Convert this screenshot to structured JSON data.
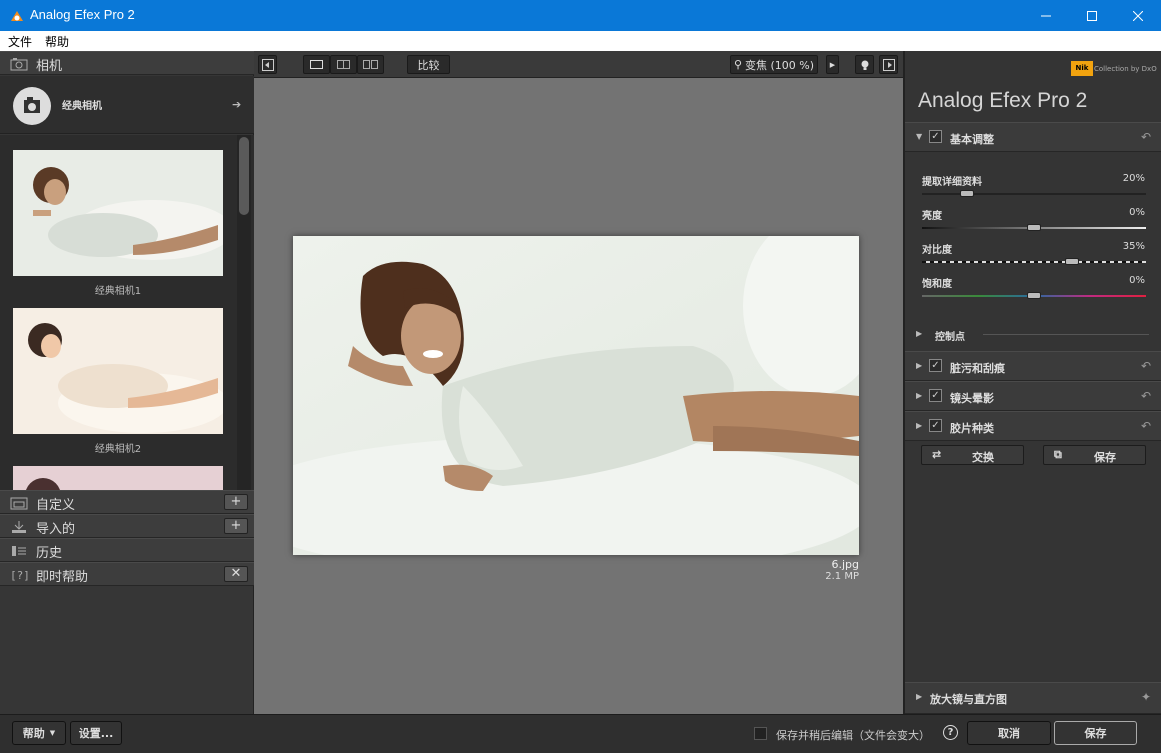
{
  "window": {
    "title": "Analog Efex Pro 2"
  },
  "menu": [
    "文件",
    "帮助"
  ],
  "left_panel": {
    "header_camera": "相机",
    "camera_label": "经典相机",
    "thumbnails": [
      {
        "label": "经典相机1"
      },
      {
        "label": "经典相机2"
      }
    ],
    "sections": [
      {
        "label": "自定义",
        "icon": "folder-icon",
        "action": "+"
      },
      {
        "label": "导入的",
        "icon": "import-icon",
        "action": "+"
      },
      {
        "label": "历史",
        "icon": "history-icon",
        "action": ""
      },
      {
        "label": "即时帮助",
        "icon": "help-icon",
        "action": "✕"
      }
    ]
  },
  "toolbar": {
    "compare_label": "比较",
    "zoom_label": "变焦 (100 %)"
  },
  "canvas": {
    "file_name": "6.jpg",
    "file_size": "2.1 MP"
  },
  "right_panel": {
    "brand_logo": "Nik",
    "brand_text": "Collection by DxO",
    "product_title": "Analog Efex Pro 2",
    "basic_section": "基本调整",
    "sliders": [
      {
        "label": "提取详细资料",
        "value": "20%",
        "level": 0.2
      },
      {
        "label": "亮度",
        "value": "0%",
        "level": 0.5
      },
      {
        "label": "对比度",
        "value": "35%",
        "level": 0.67
      },
      {
        "label": "饱和度",
        "value": "0%",
        "level": 0.5
      }
    ],
    "control_points": "控制点",
    "sections": [
      "脏污和刮痕",
      "镜头晕影",
      "胶片种类"
    ],
    "shuffle_label": "交换",
    "save_preset_label": "保存",
    "loupe_label": "放大镜与直方图"
  },
  "bottom": {
    "help_label": "帮助",
    "settings_label": "设置...",
    "save_edit_label": "保存并稍后编辑（文件会变大）",
    "cancel_label": "取消",
    "save_label": "保存"
  }
}
